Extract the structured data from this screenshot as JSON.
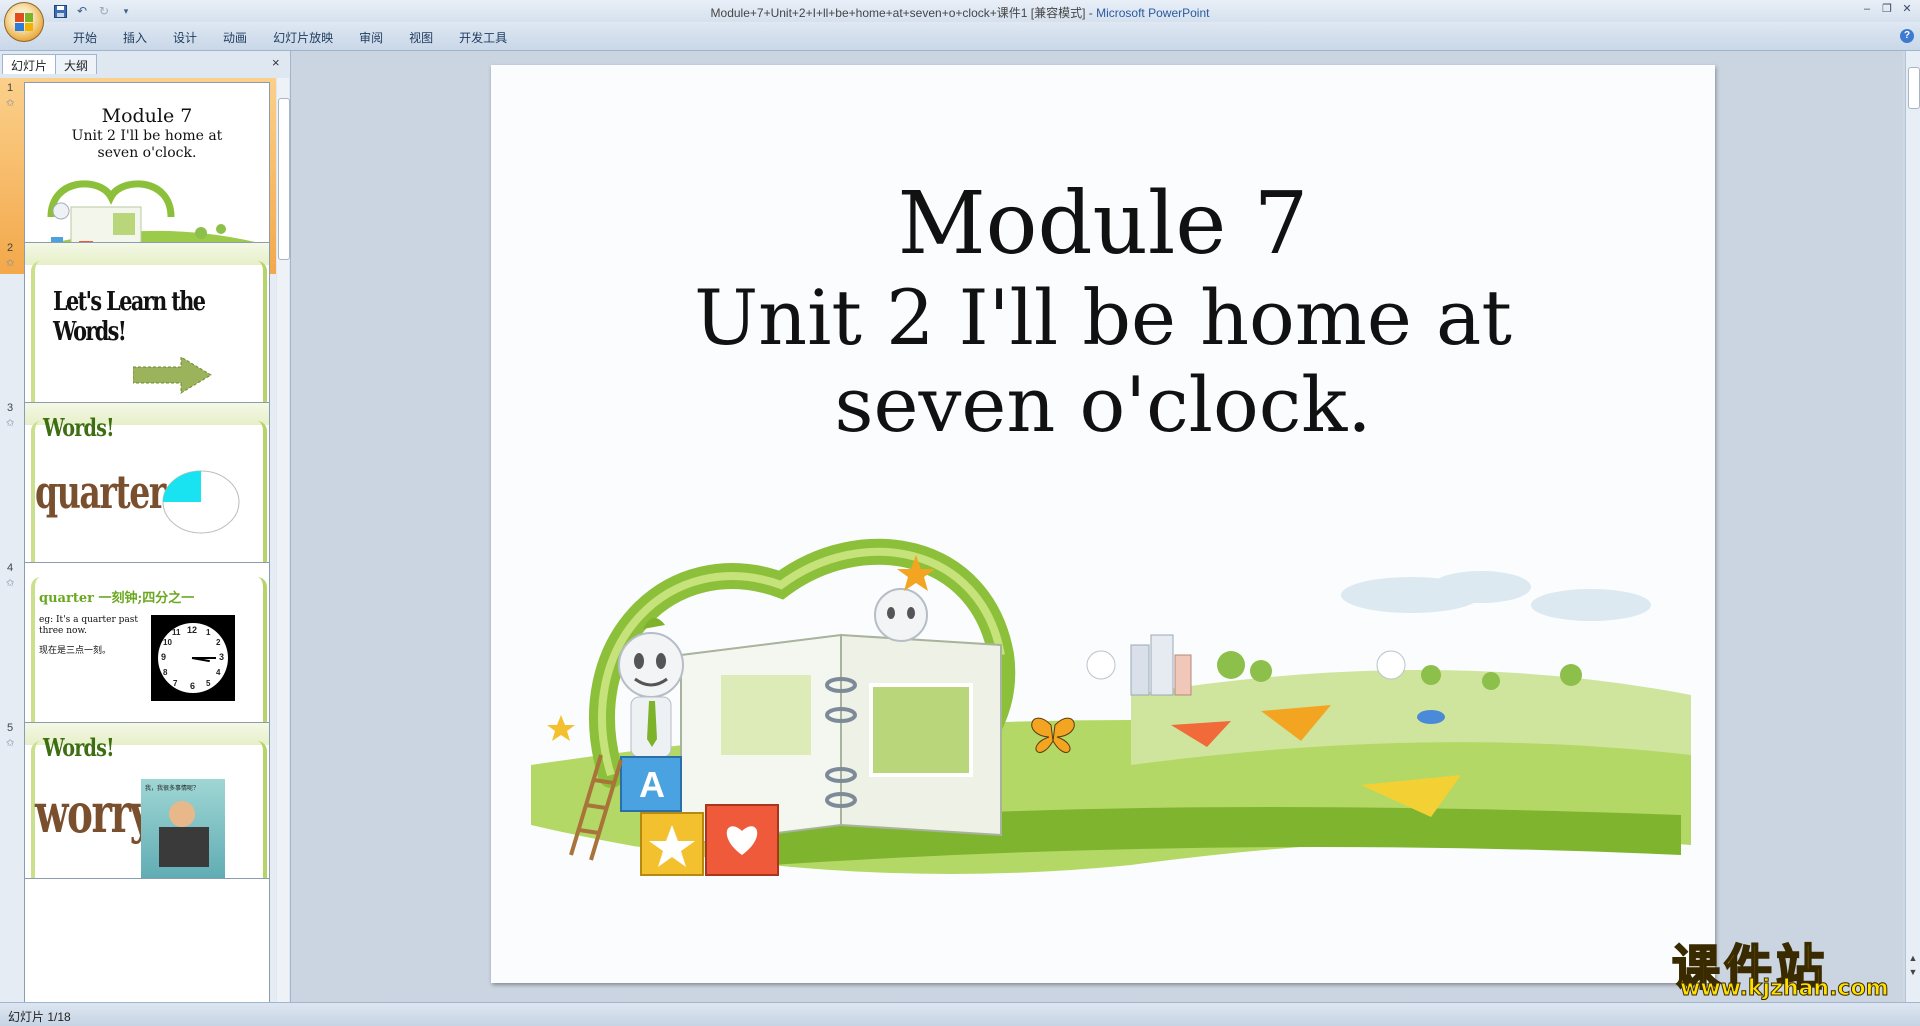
{
  "window": {
    "title": "Module+7+Unit+2+I+ll+be+home+at+seven+o+clock+课件1 [兼容模式] - ",
    "app_name": "Microsoft PowerPoint"
  },
  "ribbon": {
    "tabs": [
      "开始",
      "插入",
      "设计",
      "动画",
      "幻灯片放映",
      "审阅",
      "视图",
      "开发工具"
    ]
  },
  "pane": {
    "tabs": [
      "幻灯片",
      "大纲"
    ],
    "close": "×"
  },
  "thumbnails": [
    {
      "num": "1",
      "line1": "Module 7",
      "line2": "Unit 2 I'll be home at",
      "line3": "seven o'clock."
    },
    {
      "num": "2",
      "title": "Let's Learn the Words!"
    },
    {
      "num": "3",
      "heading": "Words!",
      "word": "quarter"
    },
    {
      "num": "4",
      "header": "quarter  一刻钟;四分之一",
      "ex1": "eg: It's a quarter past three now.",
      "ex2": "现在是三点一刻。",
      "clock_numbers": [
        "12",
        "3",
        "6",
        "9",
        "10",
        "11",
        "1",
        "2",
        "4",
        "5",
        "7",
        "8"
      ]
    },
    {
      "num": "5",
      "heading": "Words!",
      "word": "worry",
      "caption": "我，我很多事情呢？"
    }
  ],
  "slide": {
    "line1": "Module 7",
    "line2": "Unit 2 I'll be home at",
    "line3": "seven o'clock."
  },
  "status": {
    "slide_indicator": "幻灯片 1/18"
  },
  "watermark": {
    "cn": "课件站",
    "url": "www.kjzhan.com"
  },
  "colors": {
    "accent_green": "#7cb32b",
    "selected_thumb": "#f3a84a",
    "watermark_yellow": "#ffe000"
  }
}
